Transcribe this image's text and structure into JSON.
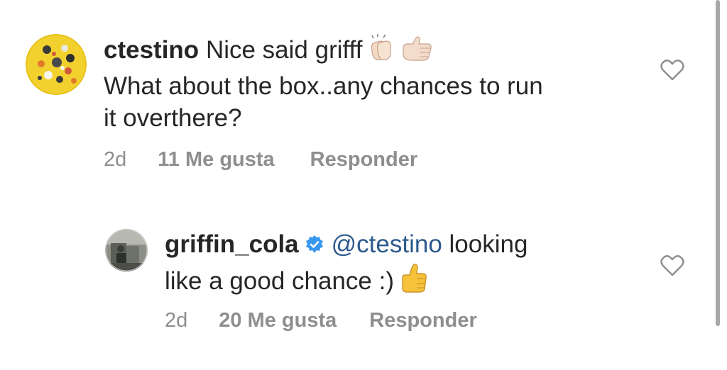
{
  "comments": [
    {
      "username": "ctestino",
      "text_line1": "Nice said grifff",
      "text_line2": "What about the box..any chances to run",
      "text_line3": "it overthere?",
      "emojis": [
        "clapping-hands-icon",
        "thumbs-left-icon"
      ],
      "time": "2d",
      "likes": "11 Me gusta",
      "reply": "Responder"
    },
    {
      "username": "griffin_cola",
      "verified": true,
      "mention": "@ctestino",
      "text_line1": "looking",
      "text_line2": "like a good chance :)",
      "emojis": [
        "thumbs-up-icon"
      ],
      "time": "2d",
      "likes": "20 Me gusta",
      "reply": "Responder"
    }
  ],
  "colors": {
    "text": "#262626",
    "meta": "#8e8e8e",
    "mention": "#2b5a8d",
    "verified": "#3897f0"
  }
}
